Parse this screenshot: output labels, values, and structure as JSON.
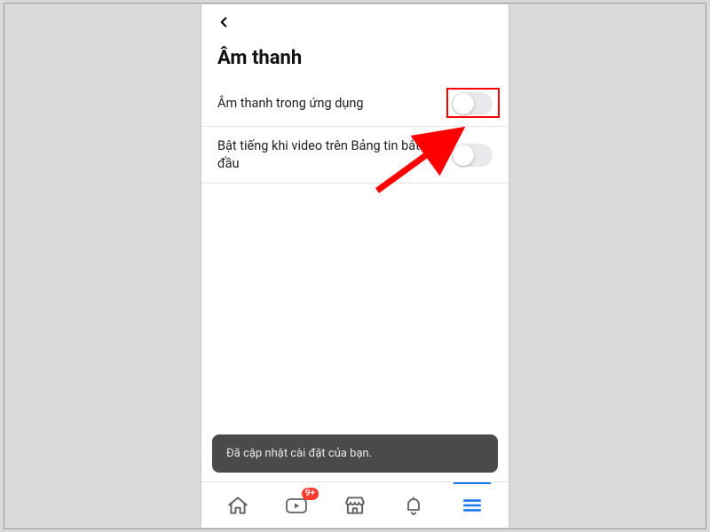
{
  "page": {
    "title": "Âm thanh"
  },
  "settings": [
    {
      "label": "Âm thanh trong ứng dụng",
      "enabled": false,
      "highlighted": true
    },
    {
      "label": "Bật tiếng khi video trên Bảng tin bắt đầu",
      "enabled": false,
      "highlighted": false
    }
  ],
  "toast": {
    "message": "Đã cập nhật cài đặt của bạn."
  },
  "tabs": {
    "watch_badge": "9+"
  },
  "colors": {
    "accent": "#1877f2",
    "badge": "#ff3b30",
    "highlight": "#ff0000"
  }
}
